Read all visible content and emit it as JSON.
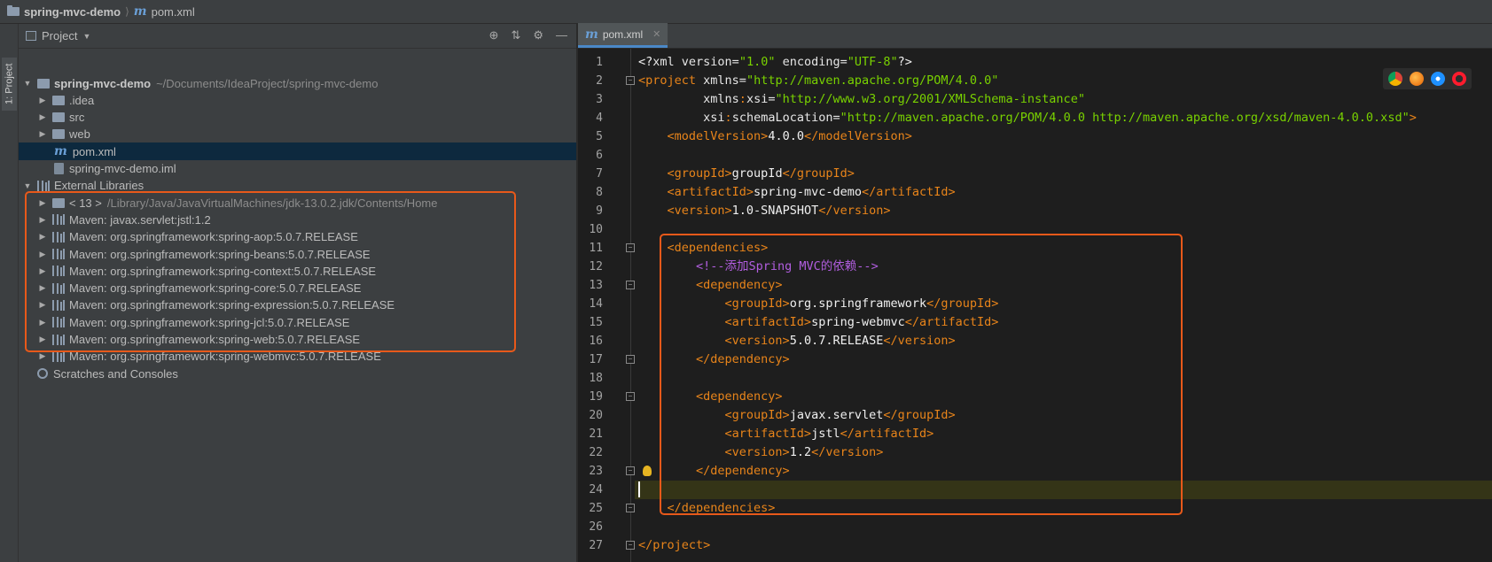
{
  "breadcrumb": {
    "project": "spring-mvc-demo",
    "separator": "⟩",
    "file": "pom.xml"
  },
  "tool_stripe": {
    "project_tab": "1: Project"
  },
  "project_panel": {
    "title": "Project",
    "tree": [
      {
        "label": "spring-mvc-demo",
        "detail": "~/Documents/IdeaProject/spring-mvc-demo",
        "icon": "folder-icon",
        "expanded": true,
        "bold": true
      },
      {
        "label": ".idea",
        "icon": "folder-icon"
      },
      {
        "label": "src",
        "icon": "folder-icon"
      },
      {
        "label": "web",
        "icon": "web-folder-icon"
      },
      {
        "label": "pom.xml",
        "icon": "maven-icon",
        "selected": true
      },
      {
        "label": "spring-mvc-demo.iml",
        "icon": "iml-file-icon"
      },
      {
        "label": "External Libraries",
        "icon": "library-icon",
        "expanded": true
      },
      {
        "label": "< 13 >",
        "detail": "/Library/Java/JavaVirtualMachines/jdk-13.0.2.jdk/Contents/Home",
        "icon": "folder-icon"
      },
      {
        "label": "Maven: javax.servlet:jstl:1.2",
        "icon": "library-icon"
      },
      {
        "label": "Maven: org.springframework:spring-aop:5.0.7.RELEASE",
        "icon": "library-icon"
      },
      {
        "label": "Maven: org.springframework:spring-beans:5.0.7.RELEASE",
        "icon": "library-icon"
      },
      {
        "label": "Maven: org.springframework:spring-context:5.0.7.RELEASE",
        "icon": "library-icon"
      },
      {
        "label": "Maven: org.springframework:spring-core:5.0.7.RELEASE",
        "icon": "library-icon"
      },
      {
        "label": "Maven: org.springframework:spring-expression:5.0.7.RELEASE",
        "icon": "library-icon"
      },
      {
        "label": "Maven: org.springframework:spring-jcl:5.0.7.RELEASE",
        "icon": "library-icon"
      },
      {
        "label": "Maven: org.springframework:spring-web:5.0.7.RELEASE",
        "icon": "library-icon"
      },
      {
        "label": "Maven: org.springframework:spring-webmvc:5.0.7.RELEASE",
        "icon": "library-icon"
      },
      {
        "label": "Scratches and Consoles",
        "icon": "scratches-icon"
      }
    ]
  },
  "editor": {
    "tab_label": "pom.xml",
    "current_line": 24,
    "lines": [
      {
        "n": "1",
        "segs": [
          [
            "tx",
            "<?"
          ],
          [
            "at",
            "xml version="
          ],
          [
            "av",
            "\"1.0\""
          ],
          [
            "at",
            " encoding="
          ],
          [
            "av",
            "\"UTF-8\""
          ],
          [
            "tx",
            "?>"
          ]
        ]
      },
      {
        "n": "2",
        "segs": [
          [
            "tg",
            "<project "
          ],
          [
            "at",
            "xmlns="
          ],
          [
            "av",
            "\"http://maven.apache.org/POM/4.0.0\""
          ]
        ]
      },
      {
        "n": "3",
        "segs": [
          [
            "at",
            "         xmlns"
          ],
          [
            "tg",
            ":"
          ],
          [
            "at",
            "xsi="
          ],
          [
            "av",
            "\"http://www.w3.org/2001/XMLSchema-instance\""
          ]
        ]
      },
      {
        "n": "4",
        "segs": [
          [
            "at",
            "         xsi"
          ],
          [
            "tg",
            ":"
          ],
          [
            "at",
            "schemaLocation="
          ],
          [
            "av",
            "\"http://maven.apache.org/POM/4.0.0 http://maven.apache.org/xsd/maven-4.0.0.xsd\""
          ],
          [
            "tg",
            ">"
          ]
        ]
      },
      {
        "n": "5",
        "segs": [
          [
            "tg",
            "    <modelVersion>"
          ],
          [
            "tx",
            "4.0.0"
          ],
          [
            "tg",
            "</modelVersion>"
          ]
        ]
      },
      {
        "n": "6",
        "segs": []
      },
      {
        "n": "7",
        "segs": [
          [
            "tg",
            "    <groupId>"
          ],
          [
            "tx",
            "groupId"
          ],
          [
            "tg",
            "</groupId>"
          ]
        ]
      },
      {
        "n": "8",
        "segs": [
          [
            "tg",
            "    <artifactId>"
          ],
          [
            "tx",
            "spring-mvc-demo"
          ],
          [
            "tg",
            "</artifactId>"
          ]
        ]
      },
      {
        "n": "9",
        "segs": [
          [
            "tg",
            "    <version>"
          ],
          [
            "tx",
            "1.0-SNAPSHOT"
          ],
          [
            "tg",
            "</version>"
          ]
        ]
      },
      {
        "n": "10",
        "segs": []
      },
      {
        "n": "11",
        "segs": [
          [
            "tg",
            "    <dependencies>"
          ]
        ]
      },
      {
        "n": "12",
        "segs": [
          [
            "cm",
            "        <!--添加Spring MVC的依赖-->"
          ]
        ]
      },
      {
        "n": "13",
        "segs": [
          [
            "tg",
            "        <dependency>"
          ]
        ]
      },
      {
        "n": "14",
        "segs": [
          [
            "tg",
            "            <groupId>"
          ],
          [
            "tx",
            "org.springframework"
          ],
          [
            "tg",
            "</groupId>"
          ]
        ]
      },
      {
        "n": "15",
        "segs": [
          [
            "tg",
            "            <artifactId>"
          ],
          [
            "tx",
            "spring-webmvc"
          ],
          [
            "tg",
            "</artifactId>"
          ]
        ]
      },
      {
        "n": "16",
        "segs": [
          [
            "tg",
            "            <version>"
          ],
          [
            "tx",
            "5.0.7.RELEASE"
          ],
          [
            "tg",
            "</version>"
          ]
        ]
      },
      {
        "n": "17",
        "segs": [
          [
            "tg",
            "        </dependency>"
          ]
        ]
      },
      {
        "n": "18",
        "segs": []
      },
      {
        "n": "19",
        "segs": [
          [
            "tg",
            "        <dependency>"
          ]
        ]
      },
      {
        "n": "20",
        "segs": [
          [
            "tg",
            "            <groupId>"
          ],
          [
            "tx",
            "javax.servlet"
          ],
          [
            "tg",
            "</groupId>"
          ]
        ]
      },
      {
        "n": "21",
        "segs": [
          [
            "tg",
            "            <artifactId>"
          ],
          [
            "tx",
            "jstl"
          ],
          [
            "tg",
            "</artifactId>"
          ]
        ]
      },
      {
        "n": "22",
        "segs": [
          [
            "tg",
            "            <version>"
          ],
          [
            "tx",
            "1.2"
          ],
          [
            "tg",
            "</version>"
          ]
        ]
      },
      {
        "n": "23",
        "segs": [
          [
            "tg",
            "        </dependency>"
          ]
        ]
      },
      {
        "n": "24",
        "segs": [
          [
            "caret",
            ""
          ]
        ]
      },
      {
        "n": "25",
        "segs": [
          [
            "tg",
            "    </dependencies>"
          ]
        ]
      },
      {
        "n": "26",
        "segs": []
      },
      {
        "n": "27",
        "segs": [
          [
            "tg",
            "</project>"
          ]
        ]
      }
    ],
    "fold_markers_at": [
      2,
      11,
      13,
      17,
      19,
      23,
      25,
      27
    ],
    "bulb_at": 23
  },
  "browser_icons": [
    "chrome-icon",
    "firefox-icon",
    "safari-icon",
    "opera-icon"
  ],
  "colors": {
    "highlight": "#e8591a",
    "xml_tag": "#e8841a",
    "xml_value": "#79d200",
    "comment": "#b25ee0"
  }
}
